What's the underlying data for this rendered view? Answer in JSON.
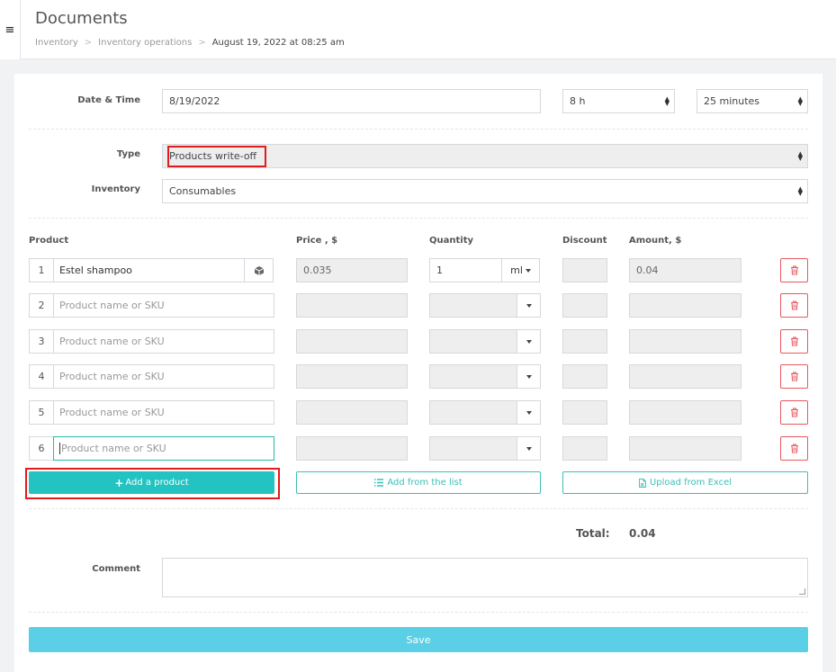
{
  "header": {
    "menu_icon": "≡",
    "title": "Documents",
    "breadcrumb": [
      "Inventory",
      "Inventory operations",
      "August 19, 2022 at 08:25 am"
    ],
    "separator": ">"
  },
  "form": {
    "datetime_label": "Date & Time",
    "date_value": "8/19/2022",
    "hour_value": "8 h",
    "minutes_value": "25 minutes",
    "type_label": "Type",
    "type_value": "Products write-off",
    "inventory_label": "Inventory",
    "inventory_value": "Consumables"
  },
  "table": {
    "headers": {
      "product": "Product",
      "price": "Price , $",
      "quantity": "Quantity",
      "discount": "Discount",
      "amount": "Amount, $"
    },
    "rows": [
      {
        "num": "1",
        "product": "Estel shampoo",
        "price": "0.035",
        "quantity": "1",
        "unit": "ml",
        "discount": "",
        "amount": "0.04"
      },
      {
        "num": "2",
        "placeholder": "Product name or SKU"
      },
      {
        "num": "3",
        "placeholder": "Product name or SKU"
      },
      {
        "num": "4",
        "placeholder": "Product name or SKU"
      },
      {
        "num": "5",
        "placeholder": "Product name or SKU"
      },
      {
        "num": "6",
        "placeholder": "Product name or SKU"
      }
    ]
  },
  "actions": {
    "add_product": "Add a product",
    "add_from_list": "Add from the list",
    "upload_excel": "Upload from Excel"
  },
  "totals": {
    "label": "Total:",
    "value": "0.04"
  },
  "comment": {
    "label": "Comment",
    "value": ""
  },
  "save_label": "Save",
  "colors": {
    "accent": "#22c3c0",
    "save": "#5bcfe6",
    "delete": "#e8585f",
    "highlight": "#e11c1c"
  }
}
